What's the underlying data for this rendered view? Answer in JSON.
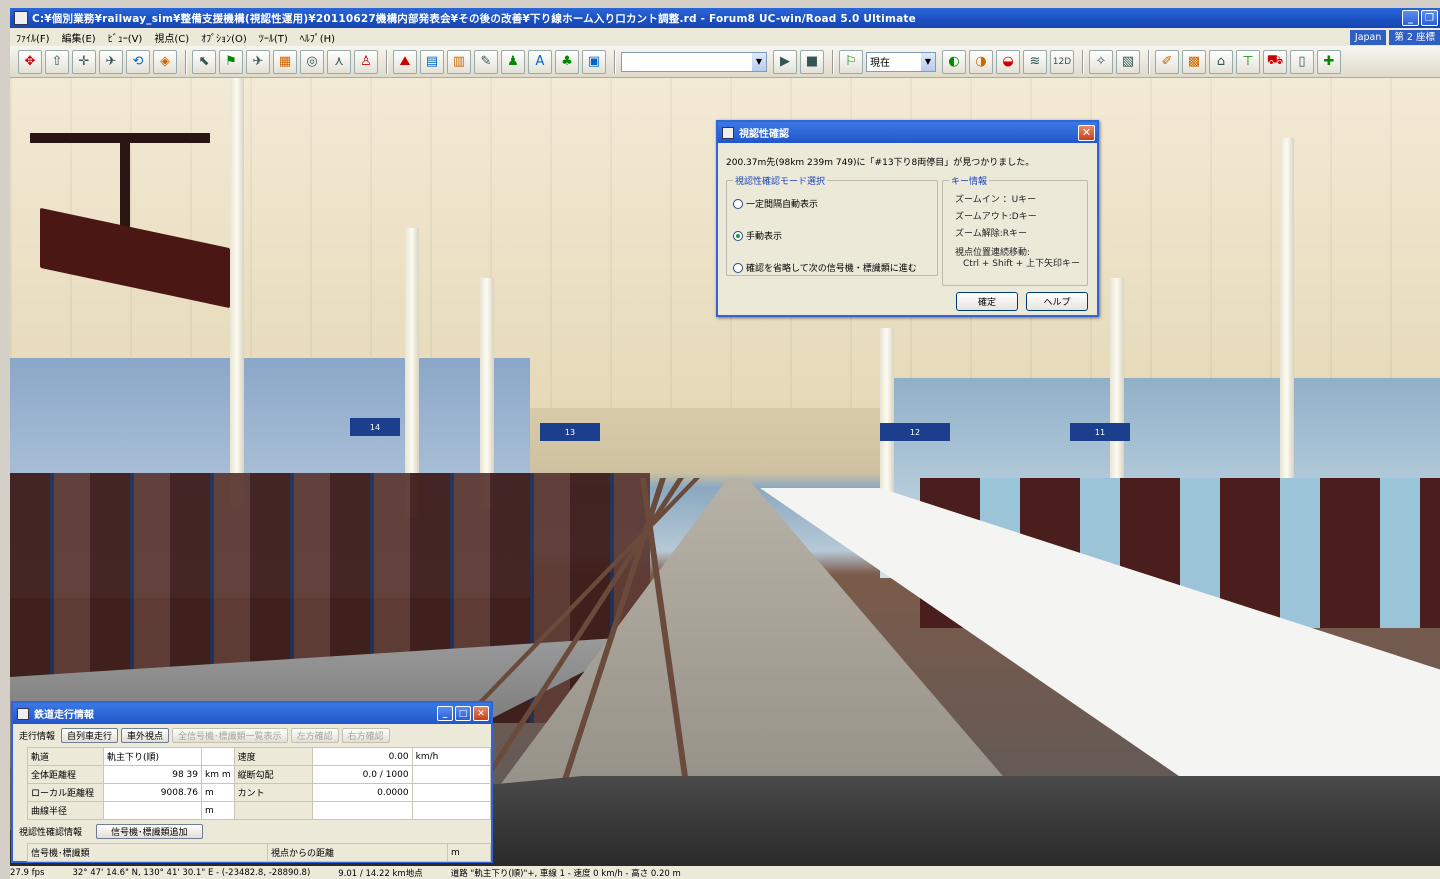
{
  "window": {
    "title": "C:¥個別業務¥railway_sim¥整備支援機構(視認性運用)¥20110627機構内部発表会¥その後の改善¥下り線ホーム入り口カント調整.rd - Forum8 UC-win/Road 5.0 Ultimate"
  },
  "menu": {
    "items": [
      "ﾌｧｲﾙ(F)",
      "編集(E)",
      "ﾋﾞｭｰ(V)",
      "視点(C)",
      "ｵﾌﾟｼｮﾝ(O)",
      "ﾂｰﾙ(T)",
      "ﾍﾙﾌﾟ(H)"
    ],
    "right_chips": [
      "Japan",
      "第 2 座標"
    ]
  },
  "toolbar": {
    "time_combo_value": "現在",
    "zoom_label": "12D"
  },
  "dialog": {
    "title": "視認性確認",
    "message": "200.37m先(98km 239m 749)に「#13下り8両停目」が見つかりました。",
    "mode_group_label": "視認性確認モード選択",
    "modes": [
      {
        "label": "一定間隔自動表示",
        "checked": false
      },
      {
        "label": "手動表示",
        "checked": true
      },
      {
        "label": "確認を省略して次の信号機・標識類に進む",
        "checked": false
      }
    ],
    "key_group_label": "キー情報",
    "keys": [
      "ズームイン ：Uキー",
      "ズームアウト:Dキー",
      "ズーム解除:Rキー",
      "視点位置連続移動:",
      "Ctrl + Shift + 上下矢印キー"
    ],
    "ok_label": "確定",
    "help_label": "ヘルプ"
  },
  "railway_panel": {
    "title": "鉄道走行情報",
    "run_info_label": "走行情報",
    "buttons": [
      {
        "label": "自列車走行",
        "enabled": true
      },
      {
        "label": "車外視点",
        "enabled": true
      },
      {
        "label": "全信号機･標識類一覧表示",
        "enabled": false
      },
      {
        "label": "左方確認",
        "enabled": false
      },
      {
        "label": "右方確認",
        "enabled": false
      }
    ],
    "rows": [
      {
        "label": "軌道",
        "value": "軌主下り(順)",
        "unit": "",
        "label2": "速度",
        "value2": "0.00",
        "unit2": "km/h"
      },
      {
        "label": "全体距離程",
        "value": "98 39",
        "unit": "km m",
        "label2": "縦断勾配",
        "value2": "0.0 / 1000",
        "unit2": ""
      },
      {
        "label": "ローカル距離程",
        "value": "9008.76",
        "unit": "m",
        "label2": "カント",
        "value2": "0.0000",
        "unit2": ""
      },
      {
        "label": "曲線半径",
        "value": "",
        "unit": "m",
        "label2": "",
        "value2": "",
        "unit2": ""
      }
    ],
    "visibility_label": "視認性確認情報",
    "add_signal_label": "信号機･標識類追加",
    "signal_col": "信号機･標識類",
    "distance_col": "視点からの距離",
    "distance_unit": "m"
  },
  "status": {
    "fps": "27.9 fps",
    "coords": "32° 47' 14.6\" N, 130° 41' 30.1\" E - (-23482.8, -28890.8)",
    "distance": "9.01 / 14.22 km地点",
    "road": "道路 \"軌主下り(順)\"+, 車線 1 - 速度 0 km/h - 高さ 0.20 m"
  },
  "scene": {
    "platform_numbers": [
      "14",
      "13",
      "12",
      "11"
    ]
  }
}
